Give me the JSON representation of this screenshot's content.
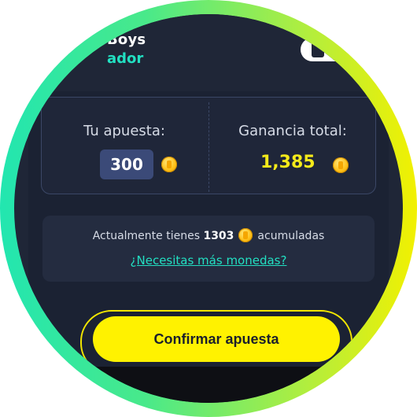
{
  "header": {
    "team_name": "Boys",
    "team_role": "ador"
  },
  "bet": {
    "your_bet_label": "Tu apuesta:",
    "your_bet_value": "300",
    "total_gain_label": "Ganancia total:",
    "total_gain_value": "1,385"
  },
  "info": {
    "prefix": "Actualmente tienes",
    "amount": "1303",
    "suffix": "acumuladas",
    "more_coins_link": "¿Necesitas más monedas?"
  },
  "actions": {
    "confirm_label": "Confirmar apuesta"
  },
  "colors": {
    "accent_yellow": "#fff200",
    "accent_teal": "#22e0c2",
    "background": "#1f2637",
    "coin": "#ffc21a"
  },
  "icons": {
    "coin": "coin-icon"
  }
}
